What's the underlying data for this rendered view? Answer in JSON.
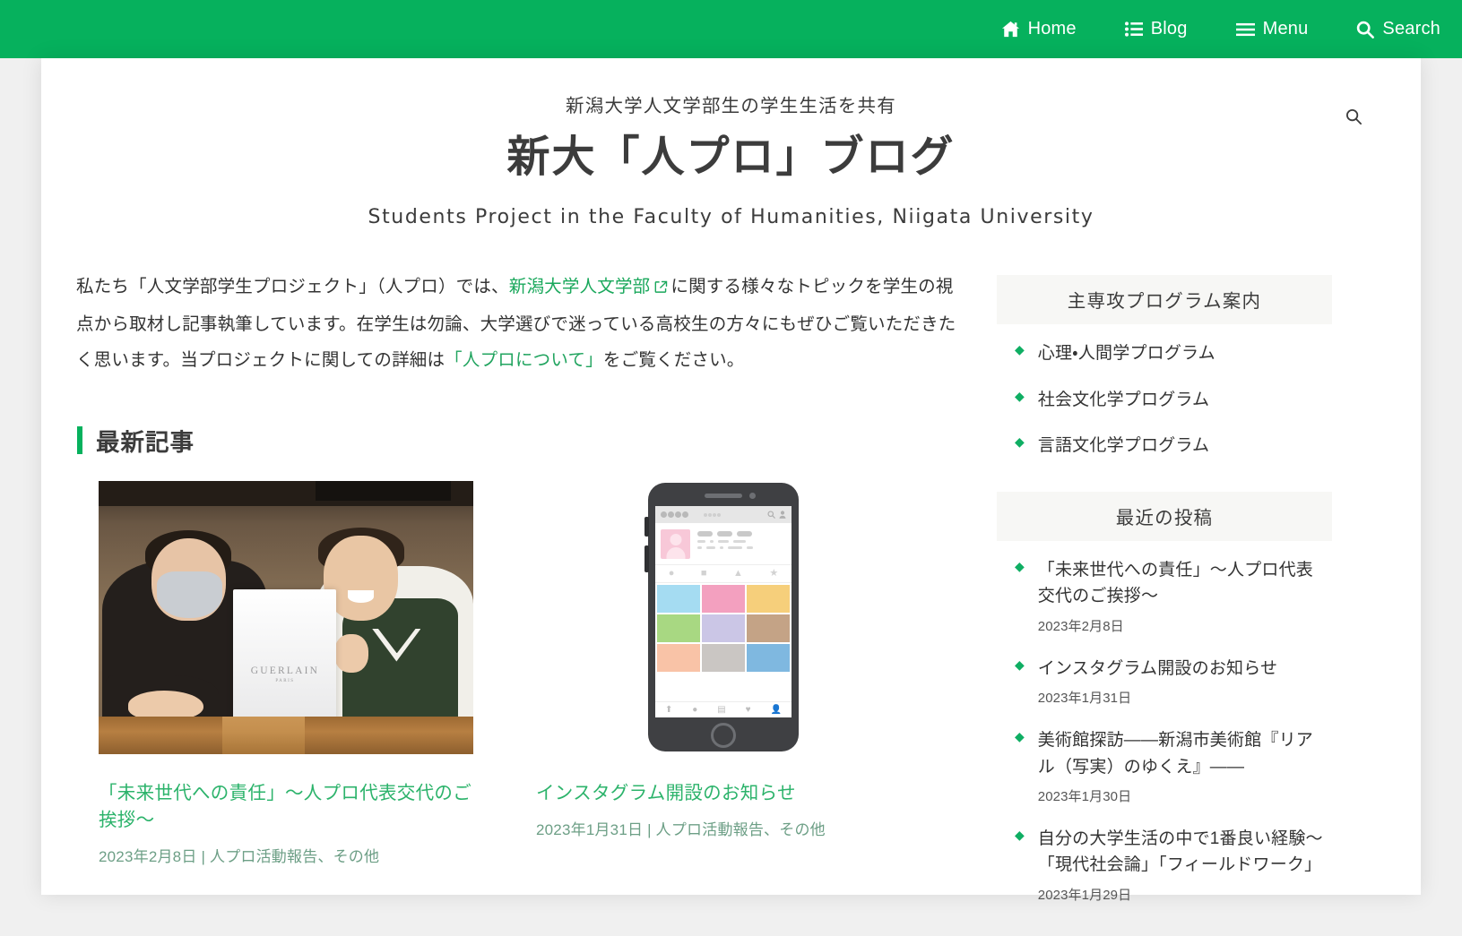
{
  "colors": {
    "brand_green": "#06b15d",
    "link_green": "#2cb36b",
    "bullet_green": "#0fae63",
    "page_bg": "#f0f0f0",
    "widget_head_bg": "#f7f7f5",
    "text_dark": "#3c3c3c"
  },
  "topbar": {
    "items": [
      {
        "label": "Home",
        "icon": "home-icon"
      },
      {
        "label": "Blog",
        "icon": "list-icon"
      },
      {
        "label": "Menu",
        "icon": "hamburger-icon"
      },
      {
        "label": "Search",
        "icon": "search-icon"
      }
    ]
  },
  "site_header": {
    "tagline": "新潟大学人文学部生の学生生活を共有",
    "title": "新大「人プロ」ブログ",
    "subtitle": "Students Project in the Faculty of Humanities, Niigata University",
    "search_icon": "search-icon"
  },
  "intro": {
    "part1": "私たち「人文学部学生プロジェクト」（人プロ）では、",
    "link1": "新潟大学人文学部",
    "external_icon": "external-link-icon",
    "part2": "に関する様々なトピックを学生の視点から取材し記事執筆しています。在学生は勿論、大学選びで迷っている高校生の方々にもぜひご覧いただきたく思います。当プロジェクトに関しての詳細は",
    "link2": "「人プロについて」",
    "part3": "をご覧ください。"
  },
  "latest": {
    "heading": "最新記事",
    "posts": [
      {
        "title": "「未来世代への責任」〜人プロ代表交代のご挨拶〜",
        "meta": "2023年2月8日 | 人プロ活動報告、その他",
        "image_alt": "GUERLAIN の紙袋を持つ二人の学生の写真"
      },
      {
        "title": "インスタグラム開設のお知らせ",
        "meta": "2023年1月31日 | 人プロ活動報告、その他",
        "image_alt": "スマートフォンのイラスト"
      }
    ]
  },
  "sidebar": {
    "programs_widget": {
      "heading": "主専攻プログラム案内",
      "items": [
        {
          "label": "心理・人間学プログラム"
        },
        {
          "label": "社会文化学プログラム"
        },
        {
          "label": "言語文化学プログラム"
        }
      ]
    },
    "recent_widget": {
      "heading": "最近の投稿",
      "items": [
        {
          "label": "「未来世代への責任」〜人プロ代表交代のご挨拶〜",
          "date": "2023年2月8日"
        },
        {
          "label": "インスタグラム開設のお知らせ",
          "date": "2023年1月31日"
        },
        {
          "label": "美術館探訪――新潟市美術館『リアル（写実）のゆくえ』――",
          "date": "2023年1月30日"
        },
        {
          "label": "自分の大学生活の中で1番良い経験〜「現代社会論」「フィールドワーク」",
          "date": "2023年1月29日"
        }
      ]
    }
  },
  "phone_illustration": {
    "grid_colors": [
      "#a5dcf2",
      "#f3a0bf",
      "#f6cf7b",
      "#a8d882",
      "#cbc6e6",
      "#c4a386",
      "#f9c3a7",
      "#cac6c3",
      "#7fb8e0"
    ]
  },
  "bag": {
    "brand": "GUERLAIN",
    "sub": "PARIS"
  }
}
